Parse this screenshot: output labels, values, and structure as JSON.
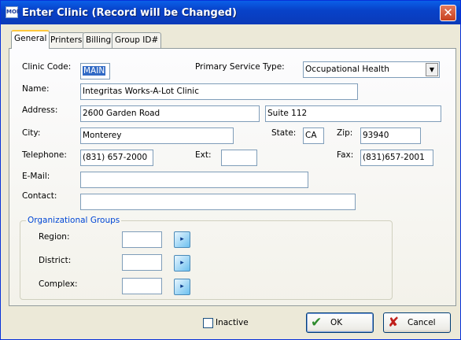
{
  "window": {
    "title": "Enter Clinic  (Record will be Changed)",
    "app_icon_text": "MOR",
    "close_glyph": "✕"
  },
  "tabs": [
    {
      "label": "General",
      "active": true
    },
    {
      "label": "Printers",
      "active": false
    },
    {
      "label": "Billing",
      "active": false
    },
    {
      "label": "Group ID#",
      "active": false
    }
  ],
  "form": {
    "clinic_code": {
      "label": "Clinic Code:",
      "value": "MAIN"
    },
    "primary_service_type": {
      "label": "Primary Service Type:",
      "value": "Occupational Health",
      "arrow": "▼"
    },
    "name": {
      "label": "Name:",
      "value": "Integritas Works-A-Lot Clinic"
    },
    "address": {
      "label": "Address:",
      "line1": "2600 Garden Road",
      "line2": "Suite 112"
    },
    "city": {
      "label": "City:",
      "value": "Monterey"
    },
    "state": {
      "label": "State:",
      "value": "CA"
    },
    "zip": {
      "label": "Zip:",
      "value": "93940"
    },
    "telephone": {
      "label": "Telephone:",
      "value": "(831) 657-2000"
    },
    "ext": {
      "label": "Ext:",
      "value": ""
    },
    "fax": {
      "label": "Fax:",
      "value": "(831)657-2001"
    },
    "email": {
      "label": "E-Mail:",
      "value": ""
    },
    "contact": {
      "label": "Contact:",
      "value": ""
    }
  },
  "org_groups": {
    "title": "Organizational Groups",
    "region": {
      "label": "Region:",
      "value": ""
    },
    "district": {
      "label": "District:",
      "value": ""
    },
    "complex": {
      "label": "Complex:",
      "value": ""
    },
    "lookup_glyph": "▸"
  },
  "footer": {
    "inactive_label": "Inactive",
    "inactive_checked": false,
    "ok_label": "OK",
    "ok_glyph": "✔",
    "cancel_label": "Cancel",
    "cancel_glyph": "✘"
  },
  "colors": {
    "titlebar": "#0842c9",
    "ok_check": "#2e8b2e",
    "cancel_x": "#c0201c",
    "group_title": "#0046d5",
    "selection": "#316ac5"
  }
}
